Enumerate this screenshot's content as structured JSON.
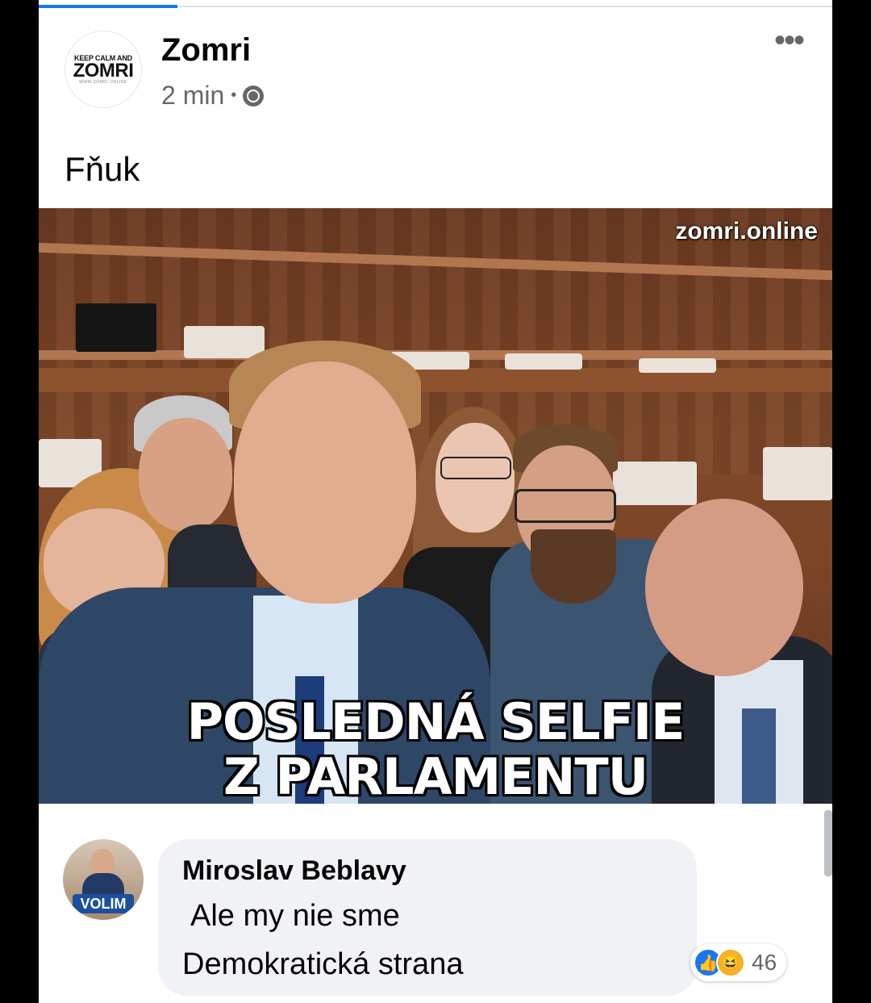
{
  "post": {
    "page_name": "Zomri",
    "time": "2 min",
    "separator": "•",
    "more_label": "•••",
    "caption": "Fňuk",
    "avatar_logo": {
      "line1": "KEEP CALM AND",
      "line2": "ZOMRI",
      "line3": "WWW.ZOMRI.ONLINE"
    }
  },
  "image": {
    "watermark": "zomri.online",
    "meme_line1": "POSLEDNÁ SELFIE",
    "meme_line2": "Z PARLAMENTU"
  },
  "comment": {
    "author": "Miroslav Beblavy",
    "text_line1": "Ale my nie sme",
    "text_line2": "Demokratická strana",
    "avatar_badge": "VOLIM",
    "reaction_count": "46",
    "reactions": [
      "like-icon",
      "haha-icon"
    ]
  },
  "colors": {
    "accent": "#1877f2",
    "bubble": "#f0f2f5",
    "muted_text": "#65676b"
  }
}
